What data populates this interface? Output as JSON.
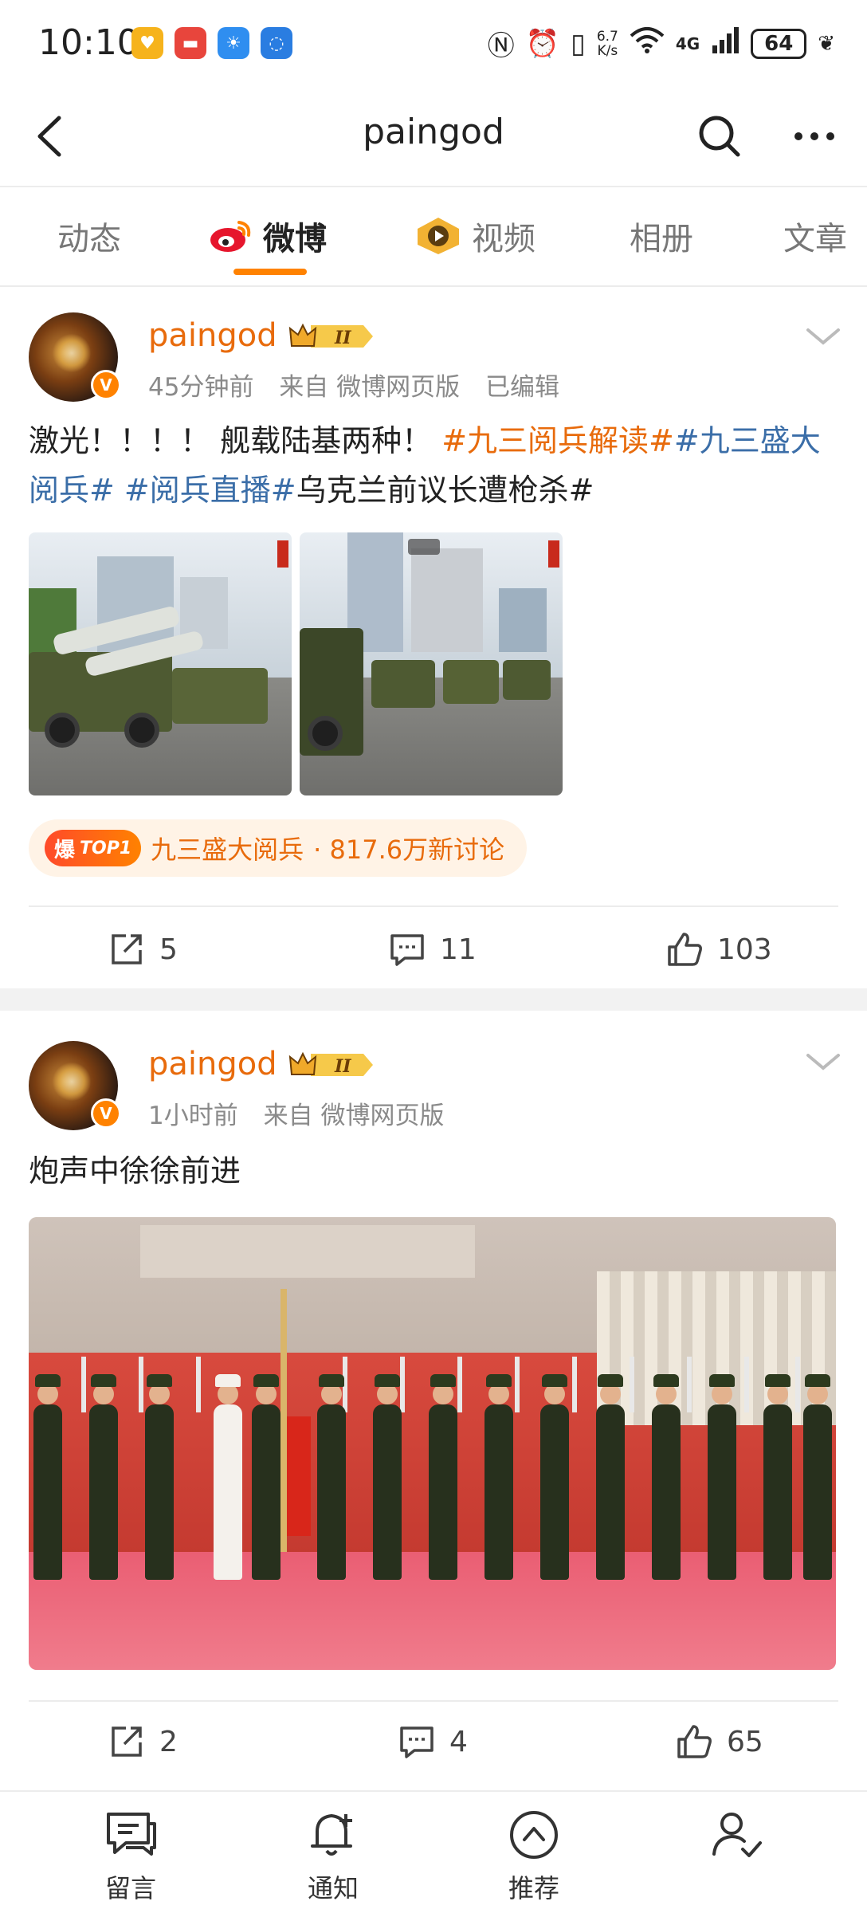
{
  "status_bar": {
    "time": "10:10",
    "net_speed_value": "6.7",
    "net_speed_unit": "K/s",
    "network": "4G",
    "battery": "64",
    "app_icons": [
      "coupon-app-icon",
      "huawei-app-icon",
      "weather-app-icon",
      "bulb-app-icon"
    ]
  },
  "nav": {
    "title": "paingod"
  },
  "tabs": [
    {
      "label": "动态",
      "active": false
    },
    {
      "label": "微博",
      "active": true
    },
    {
      "label": "视频",
      "active": false
    },
    {
      "label": "相册",
      "active": false
    },
    {
      "label": "文章",
      "active": false
    }
  ],
  "colors": {
    "accent": "#ff8200",
    "username": "#e86b0c",
    "topic_blue": "#3b6ea8"
  },
  "posts": [
    {
      "username": "paingod",
      "time": "45分钟前",
      "source": "来自 微博网页版",
      "edited": "已编辑",
      "text_plain": "激光！！！！ 舰载陆基两种！",
      "tags": [
        {
          "text": "#九三阅兵解读#",
          "color": "orange"
        },
        {
          "text": "#九三盛大阅兵#",
          "color": "blue"
        },
        {
          "text": " #阅兵直播#",
          "color": "blue"
        }
      ],
      "text_tail": "乌克兰前议长遭枪杀#",
      "topic_chip": {
        "badge_char": "爆",
        "badge_rank": "TOP1",
        "topic": "九三盛大阅兵",
        "discussions": "· 817.6万新讨论"
      },
      "reposts": "5",
      "comments": "11",
      "likes": "103"
    },
    {
      "username": "paingod",
      "time": "1小时前",
      "source": "来自 微博网页版",
      "text": "炮声中徐徐前进",
      "reposts": "2",
      "comments": "4",
      "likes": "65"
    }
  ],
  "bottom_bar": [
    {
      "label": "留言",
      "icon": "message-icon"
    },
    {
      "label": "通知",
      "icon": "bell-icon"
    },
    {
      "label": "推荐",
      "icon": "recommend-icon"
    },
    {
      "label": "",
      "icon": "follow-user-icon"
    }
  ]
}
